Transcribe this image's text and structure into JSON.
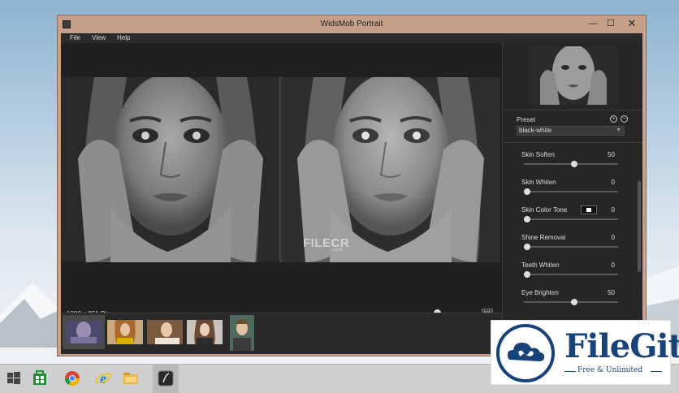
{
  "window": {
    "title": "WidsMob Portrait",
    "controls": {
      "minimize": "—",
      "maximize": "☐",
      "close": "✕"
    }
  },
  "menu": [
    "File",
    "View",
    "Help"
  ],
  "viewer": {
    "image_info": "1280 x 851 Pix",
    "zoom_level": 0.05,
    "compare_button": "B/A",
    "watermark": "FILECR",
    "watermark_sub": ".com"
  },
  "filmstrip": {
    "selected_index": 0,
    "count": 5
  },
  "sidebar": {
    "preset_label": "Preset",
    "preset_value": "black-white",
    "controls": [
      {
        "label": "Skin Soften",
        "value": "50",
        "level": 0.5
      },
      {
        "label": "Skin Whiten",
        "value": "0",
        "level": 0
      },
      {
        "label": "Skin Color Tone",
        "value": "0",
        "level": 0,
        "has_swatch": true
      },
      {
        "label": "Shine Removal",
        "value": "0",
        "level": 0
      },
      {
        "label": "Teeth Whiten",
        "value": "0",
        "level": 0
      },
      {
        "label": "Eye Brighten",
        "value": "50",
        "level": 0.5
      }
    ]
  },
  "overlay": {
    "brand": "FileGit",
    "tagline": "Free & Unlimited"
  },
  "colors": {
    "window_frame": "#c6a089",
    "client_bg": "#1f1f1f",
    "brand_blue": "#17427a"
  }
}
